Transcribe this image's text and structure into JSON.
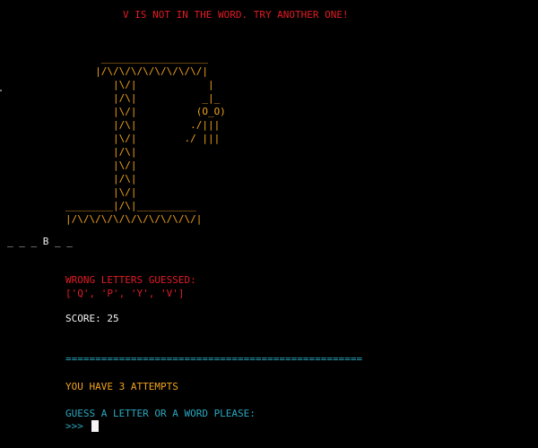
{
  "status_message": "V IS NOT IN THE WORD. TRY ANOTHER ONE!",
  "gallows_art": [
    "      __________________",
    "     |/\\/\\/\\/\\/\\/\\/\\/\\/|",
    "        |\\/|            |",
    "        |/\\|           _|_",
    "        |\\/|          (O_O)",
    "        |/\\|         ./|||",
    "        |\\/|        ./ |||",
    "        |/\\|",
    "        |\\/|",
    "        |/\\|",
    "        |\\/|",
    "________|/\\|__________",
    "|/\\/\\/\\/\\/\\/\\/\\/\\/\\/\\/|"
  ],
  "word_hint": "_ _ _ B _ _",
  "wrong_letters_title": "WRONG LETTERS GUESSED:",
  "wrong_letters_list": "['Q', 'P', 'Y', 'V']",
  "score_text": "SCORE: 25",
  "divider": "==================================================",
  "attempts_text": "YOU HAVE 3 ATTEMPTS",
  "prompt_text": "GUESS A LETTER OR A WORD PLEASE:",
  "input_prompt": ">>> "
}
